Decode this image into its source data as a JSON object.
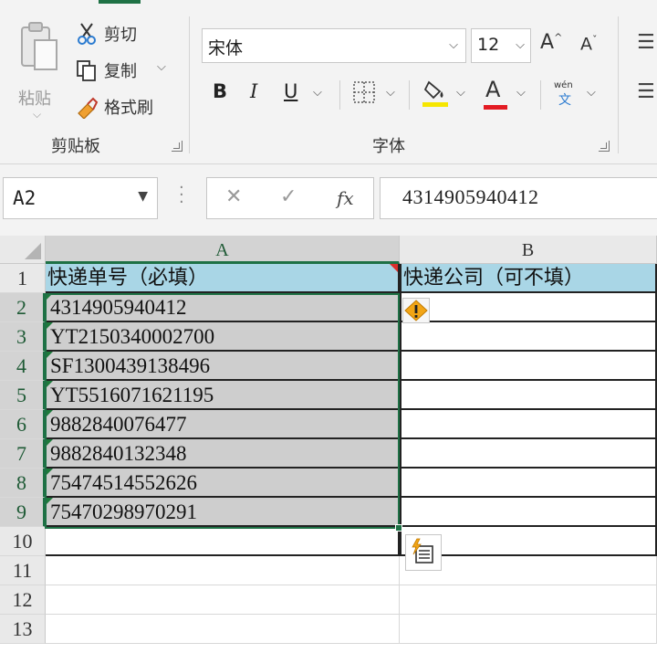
{
  "ribbon": {
    "clipboard": {
      "paste_label": "粘贴",
      "cut_label": "剪切",
      "copy_label": "复制",
      "format_painter_label": "格式刷",
      "group_label": "剪贴板"
    },
    "font": {
      "font_name": "宋体",
      "font_size": "12",
      "bold": "B",
      "italic": "I",
      "underline": "U",
      "font_color_letter": "A",
      "wen_label": "wén",
      "wen_char": "文",
      "group_label": "字体",
      "highlight_color": "#f6e600",
      "font_color": "#e31b23"
    }
  },
  "formula_bar": {
    "name_box": "A2",
    "fx_label": "fx",
    "value": "4314905940412"
  },
  "grid": {
    "columns": [
      "A",
      "B"
    ],
    "rows": [
      "1",
      "2",
      "3",
      "4",
      "5",
      "6",
      "7",
      "8",
      "9",
      "10",
      "11",
      "12",
      "13"
    ],
    "header_row": {
      "a": "快递单号（必填）",
      "b": "快递公司（可不填）"
    },
    "a_values": [
      "4314905940412",
      "YT2150340002700",
      "SF1300439138496",
      "YT5516071621195",
      "9882840076477",
      "9882840132348",
      "75474514552626",
      "75470298970291"
    ],
    "colors": {
      "header_fill": "#a9d6e6",
      "selection_fill": "#cecece",
      "accent_green": "#1e7145"
    }
  }
}
